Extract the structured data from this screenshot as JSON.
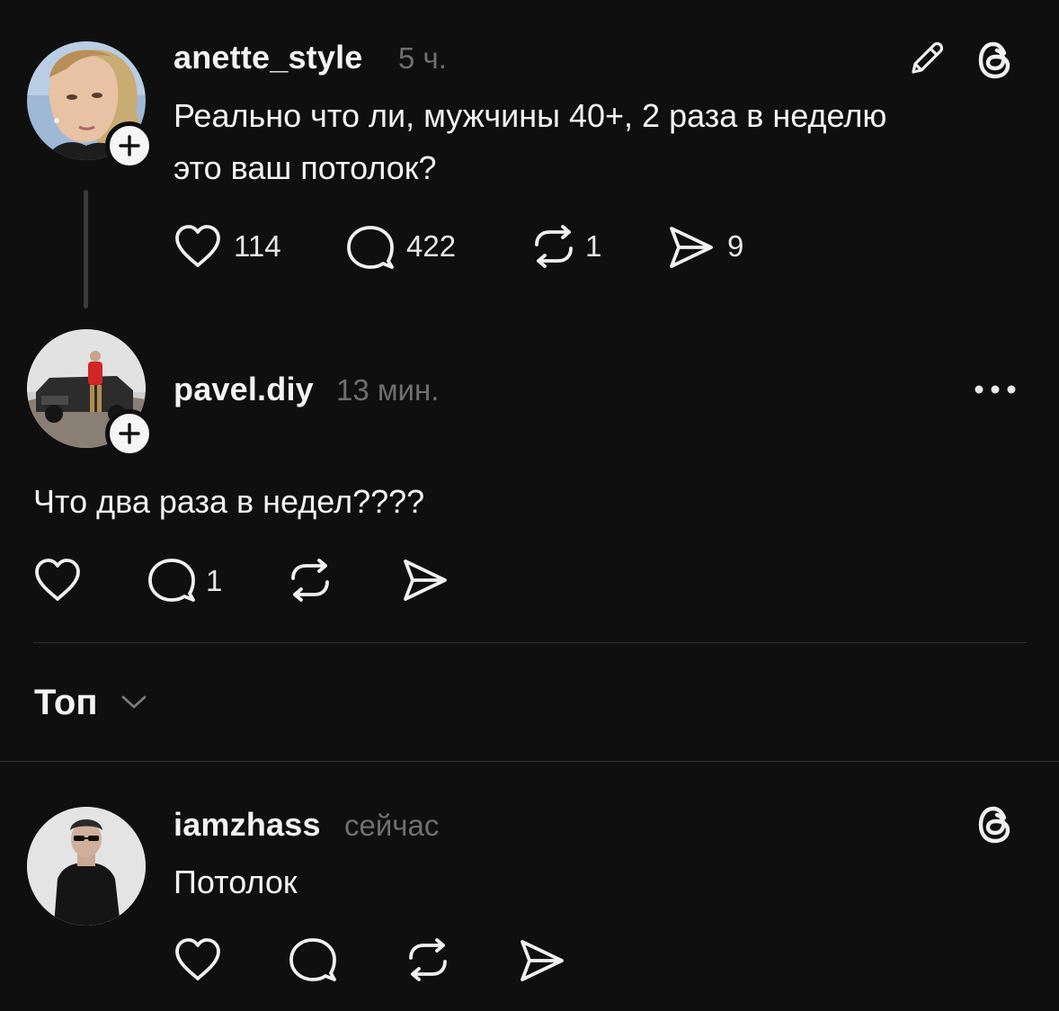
{
  "posts": [
    {
      "username": "anette_style",
      "timestamp": "5 ч.",
      "text_lines": [
        "Реально что ли, мужчины 40+, 2 раза в неделю",
        "это ваш потолок?"
      ],
      "actions": {
        "like_count": "114",
        "reply_count": "422",
        "repost_count": "1",
        "share_count": "9"
      },
      "header_icons": [
        "pencil-icon",
        "threads-logo-icon"
      ]
    },
    {
      "username": "pavel.diy",
      "timestamp": "13 мин.",
      "text": "Что два раза в недел????",
      "actions": {
        "reply_count": "1"
      },
      "header_icons": [
        "more-icon"
      ]
    }
  ],
  "sort": {
    "label": "Топ"
  },
  "replies": [
    {
      "username": "iamzhass",
      "timestamp": "сейчас",
      "text": "Потолок",
      "header_icons": [
        "threads-logo-icon"
      ]
    }
  ],
  "icons": [
    "heart-icon",
    "comment-icon",
    "repost-icon",
    "share-icon",
    "plus-icon",
    "chevron-down-icon"
  ],
  "colors": {
    "background": "#0f0f0f",
    "text": "#f3f3f3",
    "muted": "#6f6f6f",
    "divider": "#2c2c2c"
  }
}
